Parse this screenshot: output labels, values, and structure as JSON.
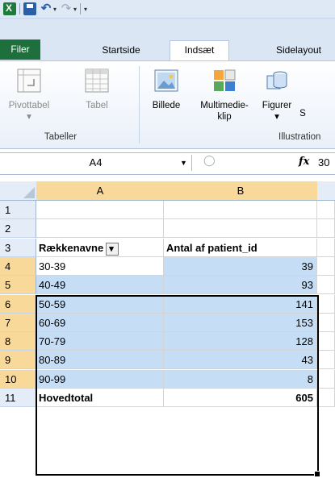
{
  "qat": {
    "icons": [
      "excel-icon",
      "save-icon",
      "undo-icon",
      "redo-icon",
      "customize-icon"
    ]
  },
  "tabs": [
    {
      "label": "Filer"
    },
    {
      "label": "Startside"
    },
    {
      "label": "Indsæt"
    },
    {
      "label": "Sidelayout"
    }
  ],
  "ribbon": {
    "pivottable": "Pivottabel",
    "tabel": "Tabel",
    "billede": "Billede",
    "multimedie": "Multimedie-",
    "multimedie2": "klip",
    "figurer": "Figurer",
    "group_tabeller": "Tabeller",
    "group_illustrationer": "Illustration"
  },
  "formula_bar": {
    "name_box": "A4",
    "fx": "fx",
    "value": "30"
  },
  "columns": [
    "A",
    "B"
  ],
  "rows": [
    {
      "n": "1",
      "a": "",
      "b": ""
    },
    {
      "n": "2",
      "a": "",
      "b": ""
    },
    {
      "n": "3",
      "a": "Rækkenavne",
      "b": "Antal af patient_id"
    },
    {
      "n": "4",
      "a": "30-39",
      "b": "39"
    },
    {
      "n": "5",
      "a": "40-49",
      "b": "93"
    },
    {
      "n": "6",
      "a": "50-59",
      "b": "141"
    },
    {
      "n": "7",
      "a": "60-69",
      "b": "153"
    },
    {
      "n": "8",
      "a": "70-79",
      "b": "128"
    },
    {
      "n": "9",
      "a": "80-89",
      "b": "43"
    },
    {
      "n": "10",
      "a": "90-99",
      "b": "8"
    },
    {
      "n": "11",
      "a": "Hovedtotal",
      "b": "605"
    }
  ]
}
